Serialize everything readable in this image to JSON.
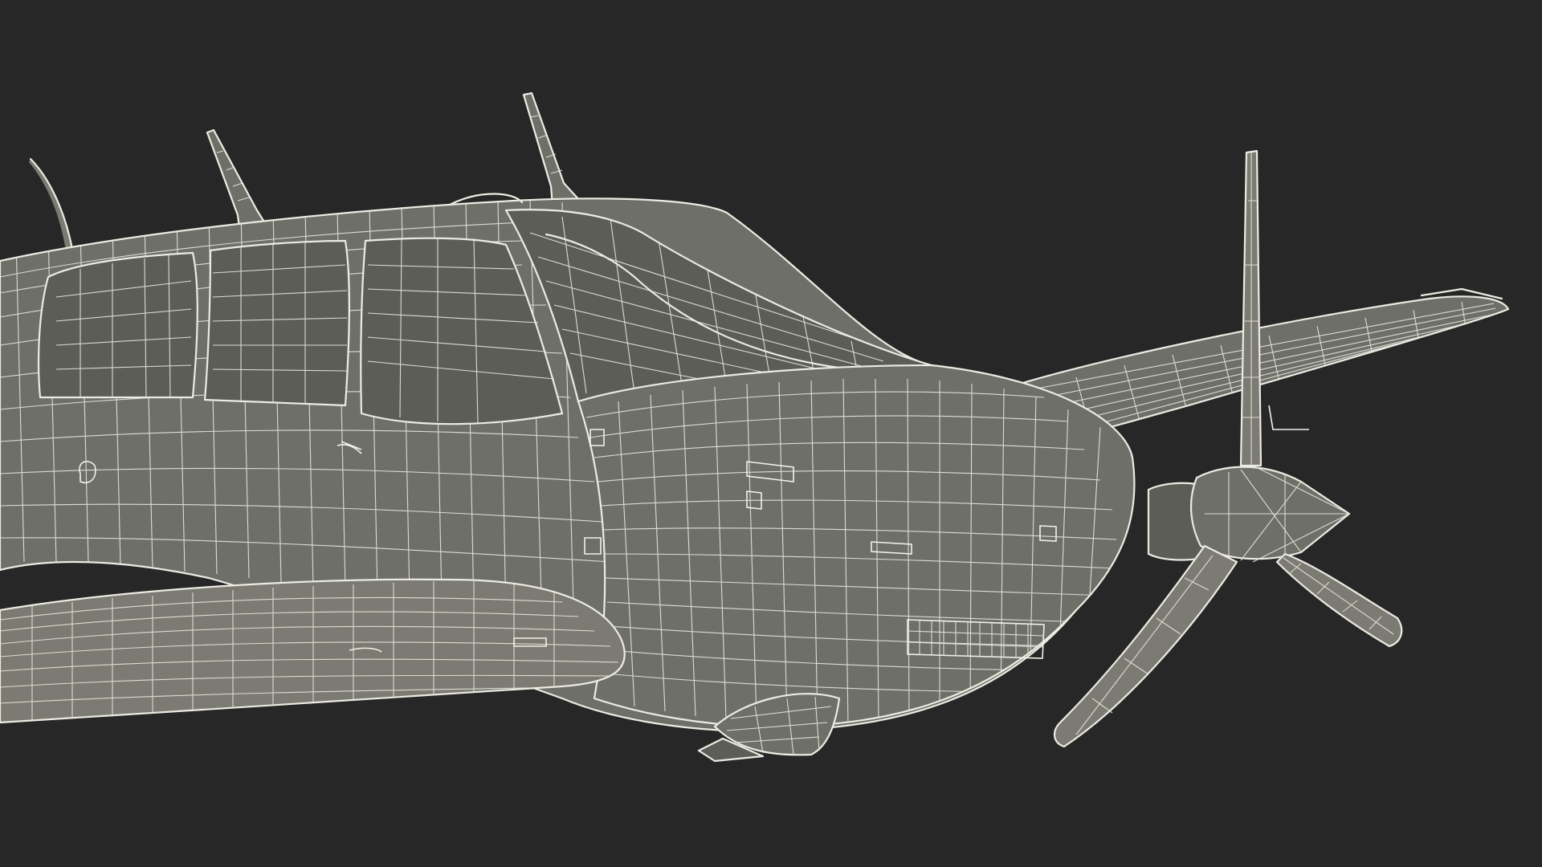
{
  "scene": {
    "subject": "airplane-wireframe",
    "colors": {
      "background": "#272727",
      "surface": "#6f6f69",
      "surface_dark": "#5d5d57",
      "wire": "#ecebe2"
    }
  }
}
